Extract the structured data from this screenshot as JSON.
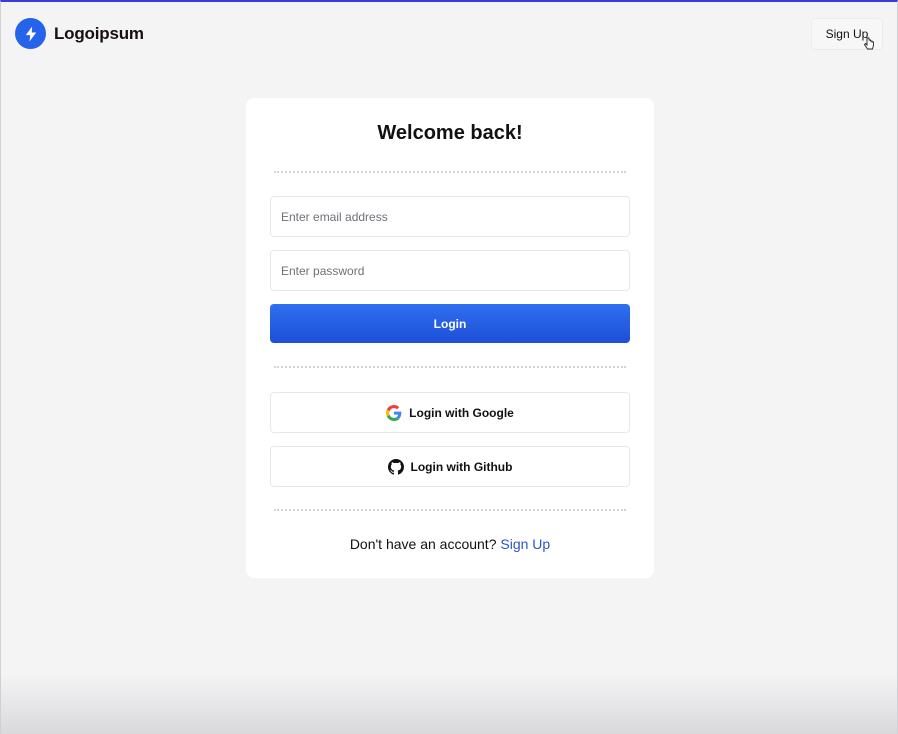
{
  "brand": {
    "name": "Logoipsum",
    "icon": "lightning-bolt-icon",
    "color": "#2563eb"
  },
  "header": {
    "signup_label": "Sign Up"
  },
  "login_card": {
    "title": "Welcome back!",
    "email": {
      "placeholder": "Enter email address",
      "value": ""
    },
    "password": {
      "placeholder": "Enter password",
      "value": ""
    },
    "login_label": "Login",
    "google_label": "Login with Google",
    "github_label": "Login with Github",
    "footer_text": "Don't have an account?",
    "footer_link": "Sign Up"
  },
  "colors": {
    "accent": "#2563eb",
    "link": "#2b54c9",
    "background": "#f4f4f5"
  }
}
